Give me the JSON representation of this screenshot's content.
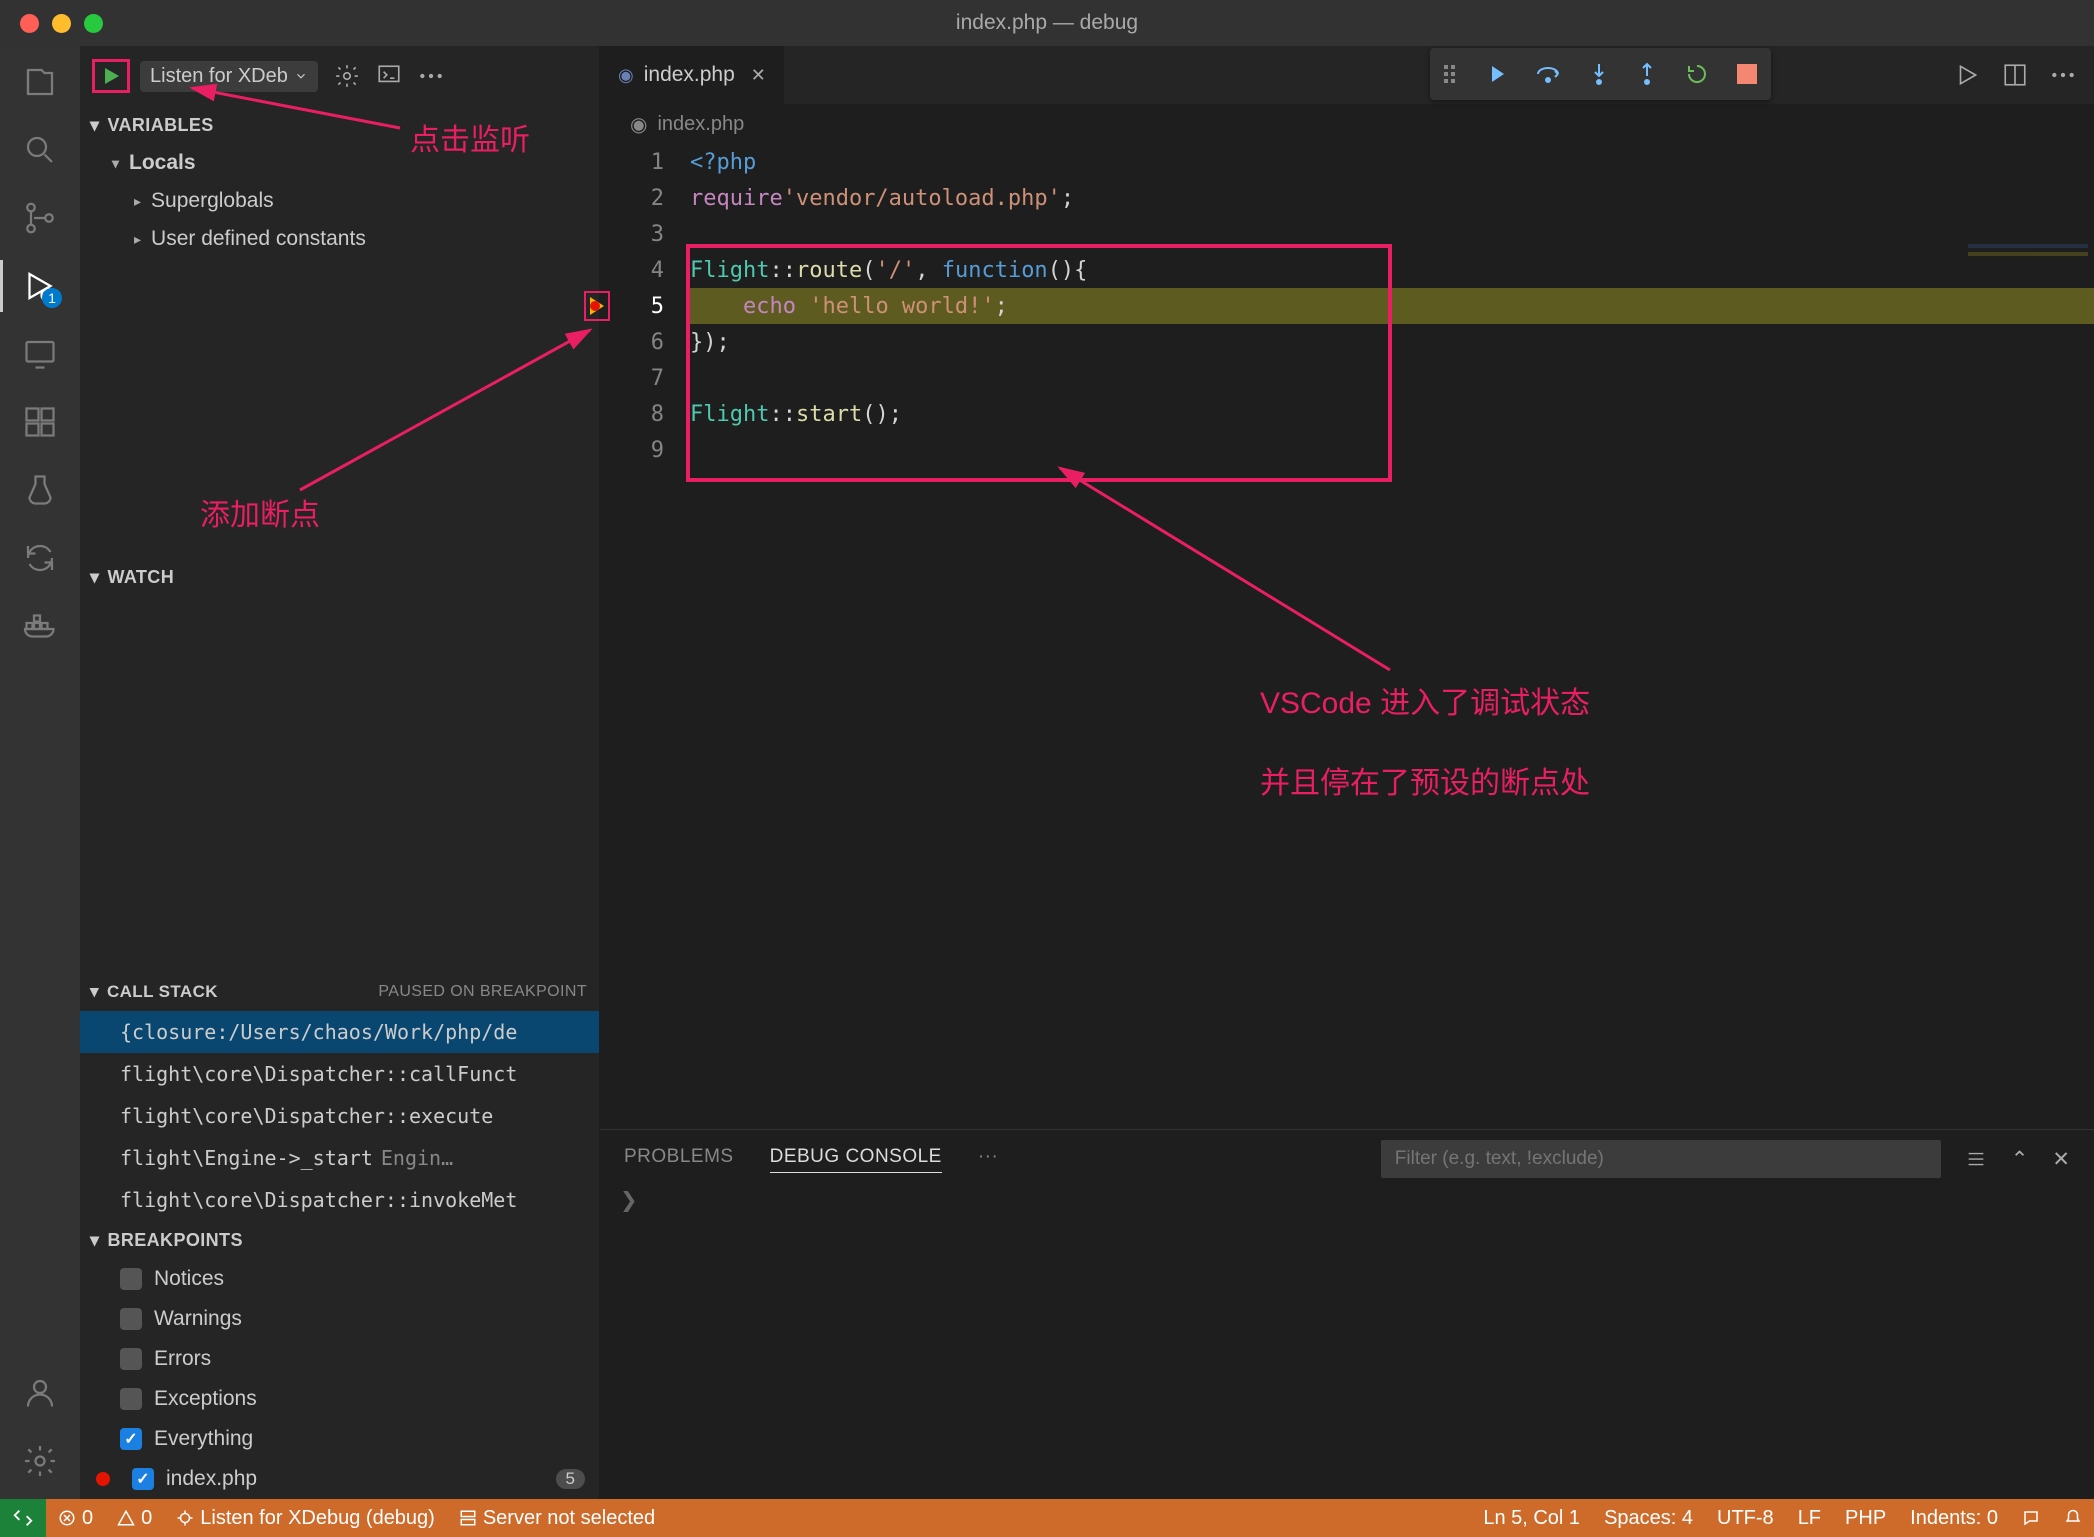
{
  "window": {
    "title": "index.php — debug"
  },
  "debug_config": {
    "label": "Listen for XDeb"
  },
  "variables": {
    "title": "VARIABLES",
    "scopes": [
      {
        "name": "Locals"
      },
      {
        "name": "Superglobals"
      },
      {
        "name": "User defined constants"
      }
    ]
  },
  "watch": {
    "title": "WATCH"
  },
  "callstack": {
    "title": "CALL STACK",
    "status": "PAUSED ON BREAKPOINT",
    "frames": [
      {
        "label": "{closure:/Users/chaos/Work/php/de"
      },
      {
        "label": "flight\\core\\Dispatcher::callFunct"
      },
      {
        "label": "flight\\core\\Dispatcher::execute"
      },
      {
        "label": "flight\\Engine->_start",
        "hint": "Engin…"
      },
      {
        "label": "flight\\core\\Dispatcher::invokeMet"
      }
    ]
  },
  "breakpoints": {
    "title": "BREAKPOINTS",
    "items": [
      {
        "label": "Notices",
        "checked": false
      },
      {
        "label": "Warnings",
        "checked": false
      },
      {
        "label": "Errors",
        "checked": false
      },
      {
        "label": "Exceptions",
        "checked": false
      },
      {
        "label": "Everything",
        "checked": true
      },
      {
        "label": "index.php",
        "checked": true,
        "has_dot": true,
        "count": "5"
      }
    ]
  },
  "tabs": {
    "file": "index.php"
  },
  "breadcrumb": {
    "file": "index.php"
  },
  "code": {
    "lines": [
      1,
      2,
      3,
      4,
      5,
      6,
      7,
      8,
      9
    ],
    "current_line": 5,
    "l1_open": "<?php",
    "l2_kw": "require",
    "l2_str": "'vendor/autoload.php'",
    "l2_semi": ";",
    "l4_cls": "Flight",
    "l4_op": "::",
    "l4_fn": "route",
    "l4_args_a": "(",
    "l4_str": "'/'",
    "l4_args_b": ", ",
    "l4_func": "function",
    "l4_args_c": "(){",
    "l5_indent": "    ",
    "l5_echo": "echo",
    "l5_sp": " ",
    "l5_str": "'hello world!'",
    "l5_semi": ";",
    "l6_close": "});",
    "l8_cls": "Flight",
    "l8_op": "::",
    "l8_fn": "start",
    "l8_end": "();"
  },
  "panel": {
    "tabs": {
      "problems": "PROBLEMS",
      "debug": "DEBUG CONSOLE"
    },
    "filter_placeholder": "Filter (e.g. text, !exclude)",
    "body_chevron": "❯"
  },
  "statusbar": {
    "errors": "0",
    "warnings": "0",
    "listen": "Listen for XDebug (debug)",
    "server": "Server not selected",
    "pos": "Ln 5, Col 1",
    "spaces": "Spaces: 4",
    "encoding": "UTF-8",
    "eol": "LF",
    "lang": "PHP",
    "indents": "Indents: 0"
  },
  "annotations": {
    "click_listen": "点击监听",
    "add_breakpoint": "添加断点",
    "debug_text1": "VSCode 进入了调试状态",
    "debug_text2": "并且停在了预设的断点处"
  }
}
